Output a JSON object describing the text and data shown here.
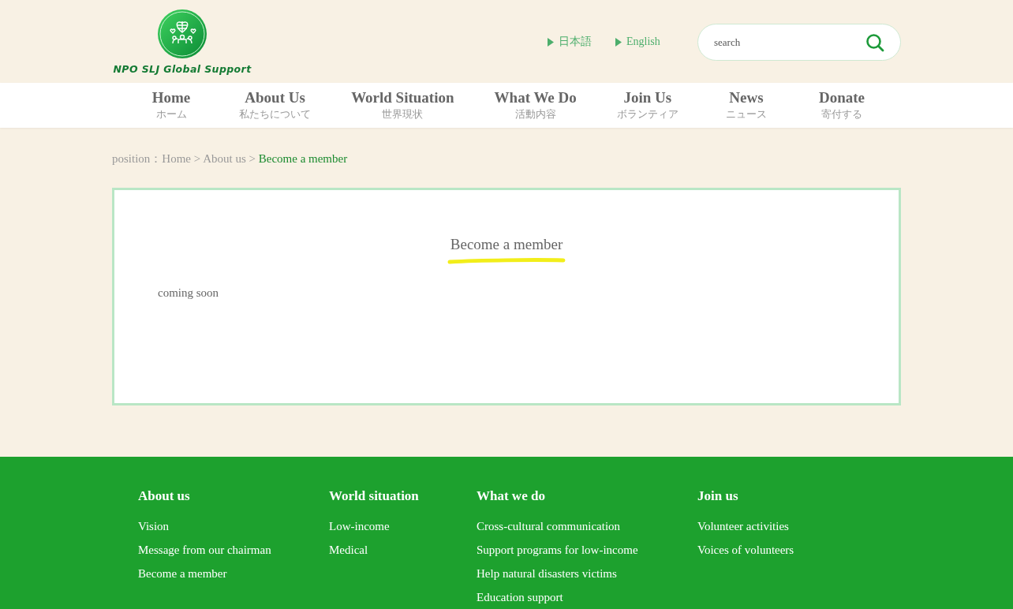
{
  "header": {
    "logo_text": "NPO SLJ Global Support",
    "languages": [
      {
        "label": "日本語"
      },
      {
        "label": "English"
      }
    ],
    "search": {
      "placeholder": "search"
    }
  },
  "nav": [
    {
      "label": "Home",
      "sub": "ホーム"
    },
    {
      "label": "About Us",
      "sub": "私たちについて"
    },
    {
      "label": "World Situation",
      "sub": "世界現状"
    },
    {
      "label": "What We Do",
      "sub": "活動内容"
    },
    {
      "label": "Join Us",
      "sub": "ボランティア"
    },
    {
      "label": "News",
      "sub": "ニュース"
    },
    {
      "label": "Donate",
      "sub": "寄付する"
    }
  ],
  "breadcrumb": {
    "prefix": "position：",
    "items": [
      {
        "label": "Home",
        "current": false
      },
      {
        "label": "About us",
        "current": false
      },
      {
        "label": "Become a member",
        "current": true
      }
    ],
    "separator": ">"
  },
  "content": {
    "title": "Become a member",
    "body": "coming soon"
  },
  "footer": [
    {
      "heading": "About us",
      "links": [
        "Vision",
        "Message from our chairman",
        "Become a member"
      ]
    },
    {
      "heading": "World situation",
      "links": [
        "Low-income",
        "Medical"
      ]
    },
    {
      "heading": "What we do",
      "links": [
        "Cross-cultural communication",
        "Support programs for low-income",
        "Help natural disasters victims",
        "Education support"
      ]
    },
    {
      "heading": "Join us",
      "links": [
        "Volunteer activities",
        "Voices of volunteers"
      ]
    }
  ]
}
